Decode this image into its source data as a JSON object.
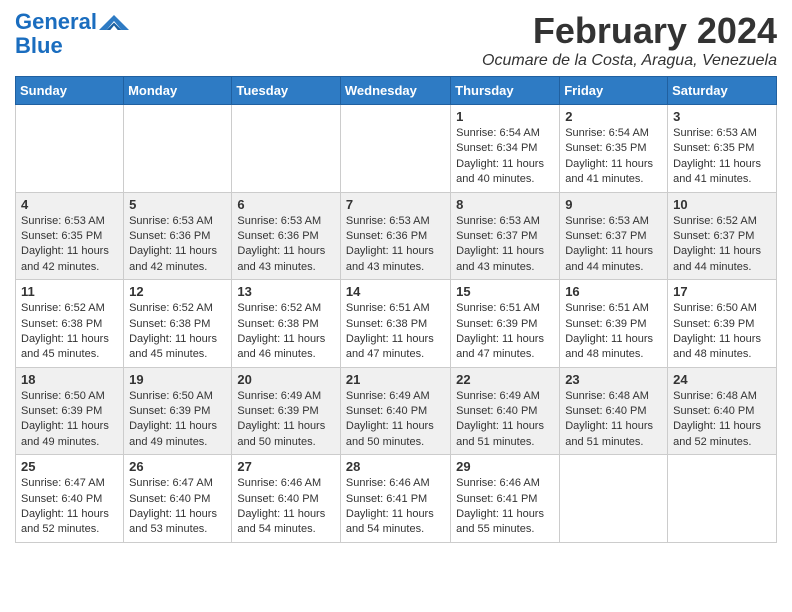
{
  "header": {
    "logo_general": "General",
    "logo_blue": "Blue",
    "title": "February 2024",
    "subtitle": "Ocumare de la Costa, Aragua, Venezuela"
  },
  "days_of_week": [
    "Sunday",
    "Monday",
    "Tuesday",
    "Wednesday",
    "Thursday",
    "Friday",
    "Saturday"
  ],
  "weeks": [
    [
      {
        "day": "",
        "content": ""
      },
      {
        "day": "",
        "content": ""
      },
      {
        "day": "",
        "content": ""
      },
      {
        "day": "",
        "content": ""
      },
      {
        "day": "1",
        "content": "Sunrise: 6:54 AM\nSunset: 6:34 PM\nDaylight: 11 hours and 40 minutes."
      },
      {
        "day": "2",
        "content": "Sunrise: 6:54 AM\nSunset: 6:35 PM\nDaylight: 11 hours and 41 minutes."
      },
      {
        "day": "3",
        "content": "Sunrise: 6:53 AM\nSunset: 6:35 PM\nDaylight: 11 hours and 41 minutes."
      }
    ],
    [
      {
        "day": "4",
        "content": "Sunrise: 6:53 AM\nSunset: 6:35 PM\nDaylight: 11 hours and 42 minutes."
      },
      {
        "day": "5",
        "content": "Sunrise: 6:53 AM\nSunset: 6:36 PM\nDaylight: 11 hours and 42 minutes."
      },
      {
        "day": "6",
        "content": "Sunrise: 6:53 AM\nSunset: 6:36 PM\nDaylight: 11 hours and 43 minutes."
      },
      {
        "day": "7",
        "content": "Sunrise: 6:53 AM\nSunset: 6:36 PM\nDaylight: 11 hours and 43 minutes."
      },
      {
        "day": "8",
        "content": "Sunrise: 6:53 AM\nSunset: 6:37 PM\nDaylight: 11 hours and 43 minutes."
      },
      {
        "day": "9",
        "content": "Sunrise: 6:53 AM\nSunset: 6:37 PM\nDaylight: 11 hours and 44 minutes."
      },
      {
        "day": "10",
        "content": "Sunrise: 6:52 AM\nSunset: 6:37 PM\nDaylight: 11 hours and 44 minutes."
      }
    ],
    [
      {
        "day": "11",
        "content": "Sunrise: 6:52 AM\nSunset: 6:38 PM\nDaylight: 11 hours and 45 minutes."
      },
      {
        "day": "12",
        "content": "Sunrise: 6:52 AM\nSunset: 6:38 PM\nDaylight: 11 hours and 45 minutes."
      },
      {
        "day": "13",
        "content": "Sunrise: 6:52 AM\nSunset: 6:38 PM\nDaylight: 11 hours and 46 minutes."
      },
      {
        "day": "14",
        "content": "Sunrise: 6:51 AM\nSunset: 6:38 PM\nDaylight: 11 hours and 47 minutes."
      },
      {
        "day": "15",
        "content": "Sunrise: 6:51 AM\nSunset: 6:39 PM\nDaylight: 11 hours and 47 minutes."
      },
      {
        "day": "16",
        "content": "Sunrise: 6:51 AM\nSunset: 6:39 PM\nDaylight: 11 hours and 48 minutes."
      },
      {
        "day": "17",
        "content": "Sunrise: 6:50 AM\nSunset: 6:39 PM\nDaylight: 11 hours and 48 minutes."
      }
    ],
    [
      {
        "day": "18",
        "content": "Sunrise: 6:50 AM\nSunset: 6:39 PM\nDaylight: 11 hours and 49 minutes."
      },
      {
        "day": "19",
        "content": "Sunrise: 6:50 AM\nSunset: 6:39 PM\nDaylight: 11 hours and 49 minutes."
      },
      {
        "day": "20",
        "content": "Sunrise: 6:49 AM\nSunset: 6:39 PM\nDaylight: 11 hours and 50 minutes."
      },
      {
        "day": "21",
        "content": "Sunrise: 6:49 AM\nSunset: 6:40 PM\nDaylight: 11 hours and 50 minutes."
      },
      {
        "day": "22",
        "content": "Sunrise: 6:49 AM\nSunset: 6:40 PM\nDaylight: 11 hours and 51 minutes."
      },
      {
        "day": "23",
        "content": "Sunrise: 6:48 AM\nSunset: 6:40 PM\nDaylight: 11 hours and 51 minutes."
      },
      {
        "day": "24",
        "content": "Sunrise: 6:48 AM\nSunset: 6:40 PM\nDaylight: 11 hours and 52 minutes."
      }
    ],
    [
      {
        "day": "25",
        "content": "Sunrise: 6:47 AM\nSunset: 6:40 PM\nDaylight: 11 hours and 52 minutes."
      },
      {
        "day": "26",
        "content": "Sunrise: 6:47 AM\nSunset: 6:40 PM\nDaylight: 11 hours and 53 minutes."
      },
      {
        "day": "27",
        "content": "Sunrise: 6:46 AM\nSunset: 6:40 PM\nDaylight: 11 hours and 54 minutes."
      },
      {
        "day": "28",
        "content": "Sunrise: 6:46 AM\nSunset: 6:41 PM\nDaylight: 11 hours and 54 minutes."
      },
      {
        "day": "29",
        "content": "Sunrise: 6:46 AM\nSunset: 6:41 PM\nDaylight: 11 hours and 55 minutes."
      },
      {
        "day": "",
        "content": ""
      },
      {
        "day": "",
        "content": ""
      }
    ]
  ]
}
